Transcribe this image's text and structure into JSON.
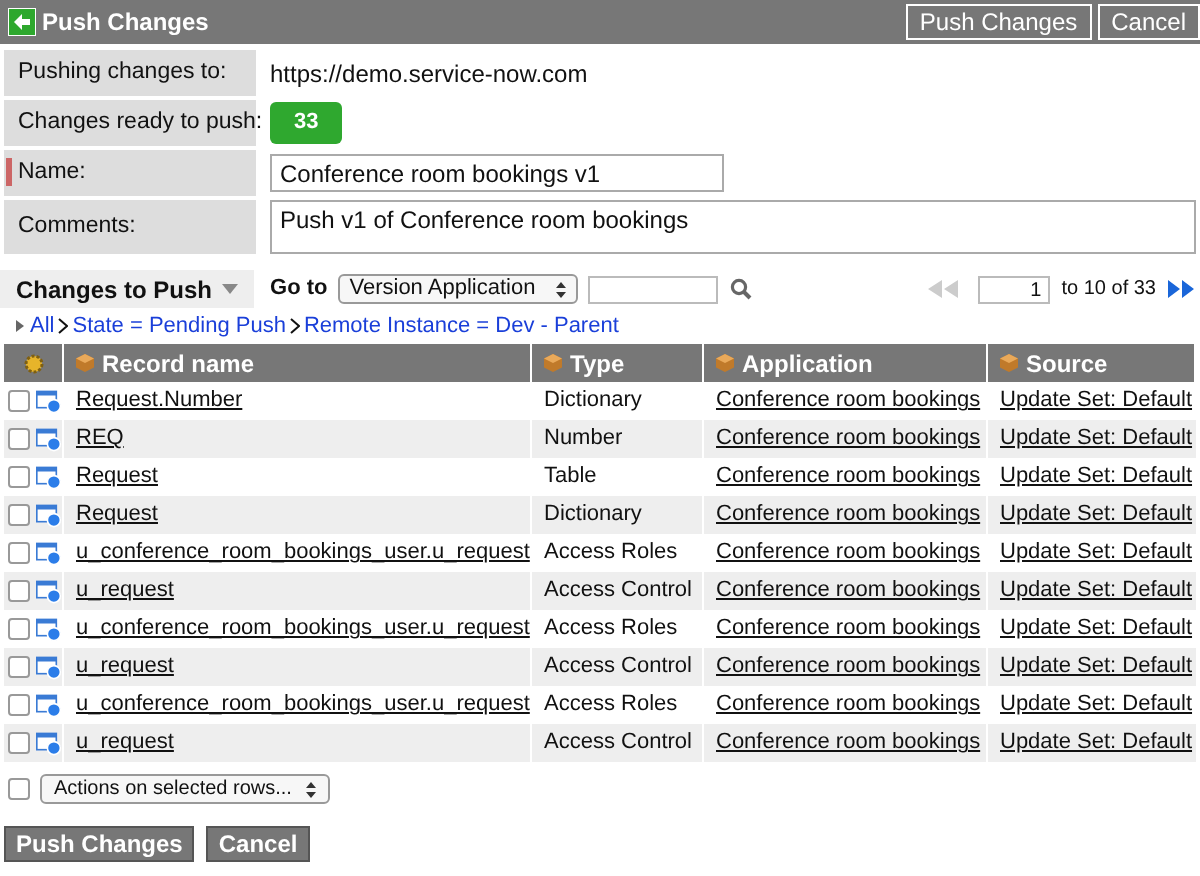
{
  "header": {
    "title": "Push Changes",
    "buttons": [
      "Push Changes",
      "Cancel"
    ]
  },
  "form": [
    {
      "kind": "text",
      "label": "Pushing changes to:",
      "value": "https://demo.service-now.com"
    },
    {
      "kind": "badge",
      "label": "Changes ready to push:",
      "value": "33"
    },
    {
      "kind": "input",
      "label": "Name:",
      "value": "Conference room bookings v1",
      "mandatory": true
    },
    {
      "kind": "textarea",
      "label": "Comments:",
      "value": "Push v1 of Conference room bookings"
    }
  ],
  "list": {
    "title": "Changes to Push",
    "goto_label": "Go to",
    "goto_select": "Version Application",
    "page": "1",
    "range": "to 10 of 33",
    "breadcrumbs": [
      "All",
      "State = Pending Push",
      "Remote Instance = Dev - Parent"
    ],
    "columns": [
      "Record name",
      "Type",
      "Application",
      "Source"
    ],
    "rows": [
      {
        "name": "Request.Number",
        "type": "Dictionary",
        "application": "Conference room bookings",
        "source": "Update Set: Default",
        "checked": false
      },
      {
        "name": "REQ",
        "type": "Number",
        "application": "Conference room bookings",
        "source": "Update Set: Default",
        "checked": false
      },
      {
        "name": "Request",
        "type": "Table",
        "application": "Conference room bookings",
        "source": "Update Set: Default",
        "checked": false
      },
      {
        "name": "Request",
        "type": "Dictionary",
        "application": "Conference room bookings",
        "source": "Update Set: Default",
        "checked": false
      },
      {
        "name": "u_conference_room_bookings_user.u_request",
        "type": "Access Roles",
        "application": "Conference room bookings",
        "source": "Update Set: Default",
        "checked": false
      },
      {
        "name": "u_request",
        "type": "Access Control",
        "application": "Conference room bookings",
        "source": "Update Set: Default",
        "checked": false
      },
      {
        "name": "u_conference_room_bookings_user.u_request",
        "type": "Access Roles",
        "application": "Conference room bookings",
        "source": "Update Set: Default",
        "checked": false
      },
      {
        "name": "u_request",
        "type": "Access Control",
        "application": "Conference room bookings",
        "source": "Update Set: Default",
        "checked": false
      },
      {
        "name": "u_conference_room_bookings_user.u_request",
        "type": "Access Roles",
        "application": "Conference room bookings",
        "source": "Update Set: Default",
        "checked": false
      },
      {
        "name": "u_request",
        "type": "Access Control",
        "application": "Conference room bookings",
        "source": "Update Set: Default",
        "checked": false
      }
    ],
    "actions": "Actions on selected rows...",
    "select_all_checked": false
  },
  "footer_buttons": [
    "Push Changes",
    "Cancel"
  ]
}
